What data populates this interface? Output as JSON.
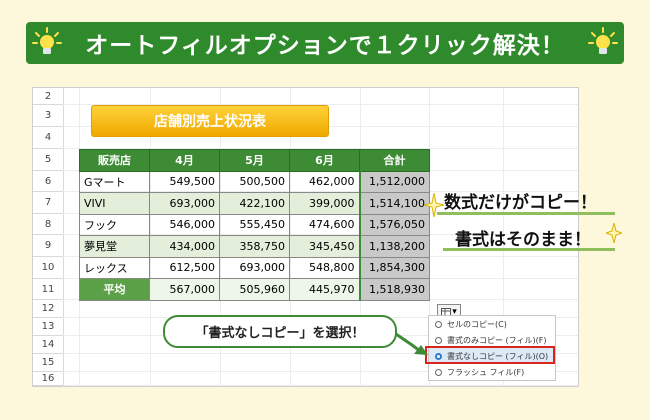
{
  "banner": {
    "title": "オートフィルオプションで１クリック解決！"
  },
  "sheet": {
    "row_numbers": [
      "2",
      "3",
      "4",
      "5",
      "6",
      "7",
      "8",
      "9",
      "10",
      "11",
      "12",
      "13",
      "14",
      "15",
      "16"
    ],
    "title": "店舗別売上状況表",
    "headers": [
      "販売店",
      "4月",
      "5月",
      "6月",
      "合計"
    ],
    "rows": [
      [
        "Gマート",
        "549,500",
        "500,500",
        "462,000",
        "1,512,000"
      ],
      [
        "VIVI",
        "693,000",
        "422,100",
        "399,000",
        "1,514,100"
      ],
      [
        "フック",
        "546,000",
        "555,450",
        "474,600",
        "1,576,050"
      ],
      [
        "夢見堂",
        "434,000",
        "358,750",
        "345,450",
        "1,138,200"
      ],
      [
        "レックス",
        "612,500",
        "693,000",
        "548,800",
        "1,854,300"
      ]
    ],
    "average_row": [
      "平均",
      "567,000",
      "505,960",
      "445,970",
      "1,518,930"
    ]
  },
  "autofill_menu": {
    "items": [
      {
        "label": "セルのコピー(C)",
        "selected": false
      },
      {
        "label": "書式のみコピー (フィル)(F)",
        "selected": false
      },
      {
        "label": "書式なしコピー (フィル)(O)",
        "selected": true
      },
      {
        "label": "フラッシュ フィル(F)",
        "selected": false
      }
    ]
  },
  "callout": {
    "text": "「書式なしコピー」を選択！"
  },
  "notes": {
    "line1": "数式だけがコピー！",
    "line2": "書式はそのまま！"
  },
  "colors": {
    "banner": "#2f8a2c",
    "header": "#3d8b35",
    "title_box": "#f5b800",
    "highlight": "#d7261f"
  }
}
